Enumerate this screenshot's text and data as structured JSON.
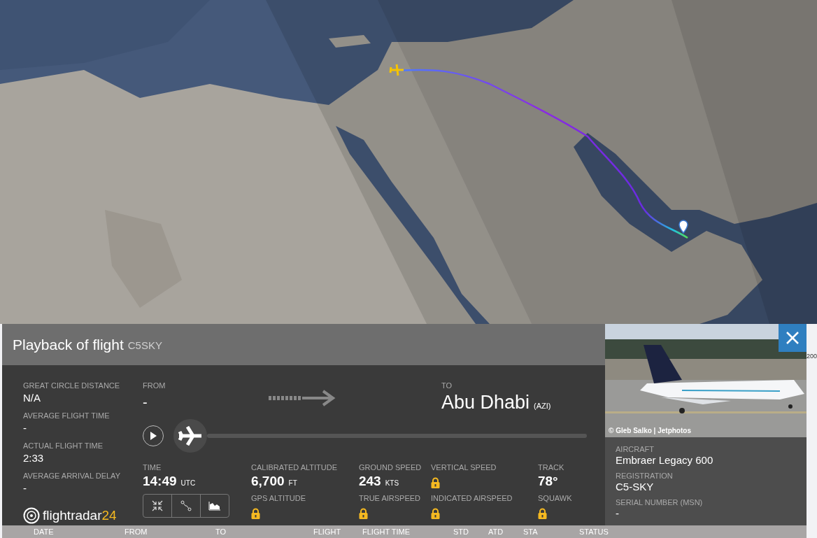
{
  "header": {
    "title": "Playback of flight",
    "callsign": "C5SKY"
  },
  "stats": [
    {
      "label": "GREAT CIRCLE DISTANCE",
      "value": "N/A"
    },
    {
      "label": "AVERAGE FLIGHT TIME",
      "value": "-"
    },
    {
      "label": "ACTUAL FLIGHT TIME",
      "value": "2:33"
    },
    {
      "label": "AVERAGE ARRIVAL DELAY",
      "value": "-"
    }
  ],
  "logo": {
    "text": "flightradar",
    "suffix": "24"
  },
  "route": {
    "from_label": "FROM",
    "from": "-",
    "to_label": "TO",
    "to": "Abu Dhabi",
    "to_code": "(AZI)"
  },
  "playback": {
    "level": 0
  },
  "metric_columns": [
    [
      {
        "kind": "value",
        "label": "TIME",
        "value": "14:49",
        "unit": "UTC"
      }
    ],
    [
      {
        "kind": "value",
        "label": "CALIBRATED ALTITUDE",
        "value": "6,700",
        "unit": "FT"
      },
      {
        "kind": "locked",
        "label": "GPS ALTITUDE"
      }
    ],
    [
      {
        "kind": "value",
        "label": "GROUND SPEED",
        "value": "243",
        "unit": "KTS"
      },
      {
        "kind": "locked",
        "label": "TRUE AIRSPEED"
      }
    ],
    [
      {
        "kind": "locked",
        "label": "VERTICAL SPEED"
      },
      {
        "kind": "locked",
        "label": "INDICATED AIRSPEED"
      }
    ],
    [
      {
        "kind": "value",
        "label": "TRACK",
        "value": "78°"
      },
      {
        "kind": "locked",
        "label": "SQUAWK"
      }
    ]
  ],
  "aircraft": {
    "photo_credit": "© Gleb Salko | Jetphotos",
    "fields": [
      {
        "label": "AIRCRAFT",
        "value": "Embraer Legacy 600"
      },
      {
        "label": "REGISTRATION",
        "value": "C5-SKY"
      },
      {
        "label": "SERIAL NUMBER (MSN)",
        "value": "-"
      }
    ]
  },
  "table_columns": [
    "DATE",
    "FROM",
    "TO",
    "FLIGHT",
    "FLIGHT TIME",
    "STD",
    "ATD",
    "STA",
    "STATUS"
  ],
  "edge_text": "200"
}
